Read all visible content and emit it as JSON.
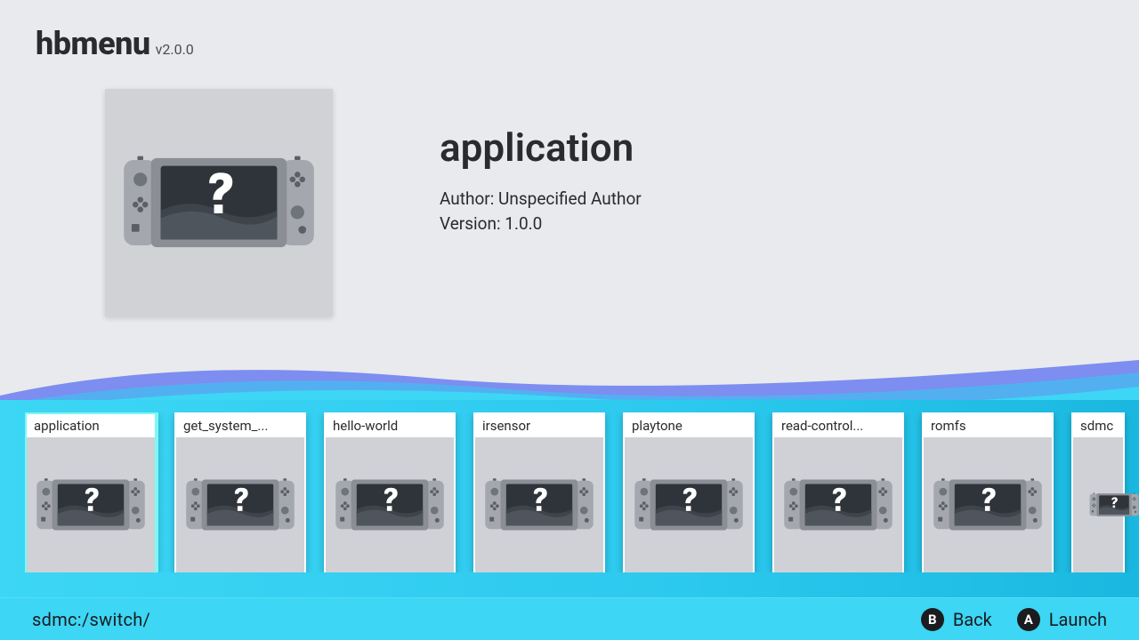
{
  "header": {
    "title": "hbmenu",
    "version": "v2.0.0"
  },
  "selected": {
    "name": "application",
    "author_label": "Author:",
    "author": "Unspecified Author",
    "version_label": "Version:",
    "version": "1.0.0"
  },
  "carousel": {
    "items": [
      {
        "label": "application"
      },
      {
        "label": "get_system_..."
      },
      {
        "label": "hello-world"
      },
      {
        "label": "irsensor"
      },
      {
        "label": "playtone"
      },
      {
        "label": "read-control..."
      },
      {
        "label": "romfs"
      },
      {
        "label": "sdmc"
      }
    ]
  },
  "footer": {
    "path": "sdmc:/switch/",
    "back": {
      "key": "B",
      "label": "Back"
    },
    "launch": {
      "key": "A",
      "label": "Launch"
    }
  }
}
